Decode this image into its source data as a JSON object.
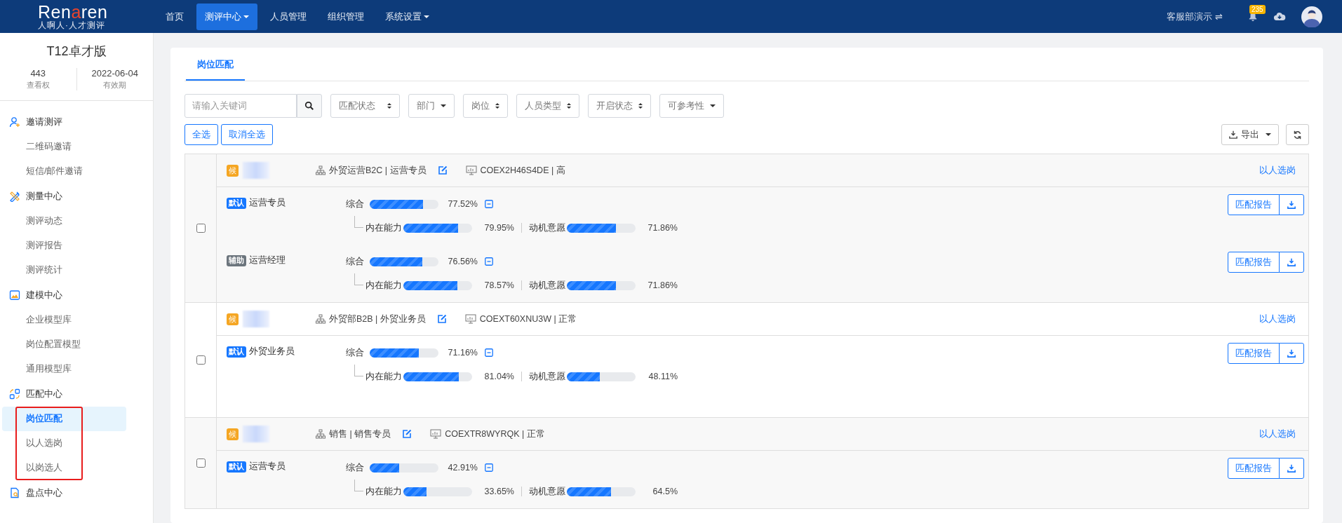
{
  "header": {
    "logo": [
      {
        "text": "Ren",
        "accent": false
      },
      {
        "text": "a",
        "accent": true
      },
      {
        "text": "ren",
        "accent": false
      }
    ],
    "tagline": "人啊人·人才测评",
    "nav": [
      {
        "label": "首页",
        "selected": false,
        "dropdown": false
      },
      {
        "label": "测评中心",
        "selected": true,
        "dropdown": true
      },
      {
        "label": "人员管理",
        "selected": false,
        "dropdown": false
      },
      {
        "label": "组织管理",
        "selected": false,
        "dropdown": false
      },
      {
        "label": "系统设置",
        "selected": false,
        "dropdown": true
      }
    ],
    "account": "客服部演示 ⇌",
    "notification_count": "235"
  },
  "sidebar": {
    "edition": "T12卓才版",
    "stats": [
      {
        "value": "443",
        "label": "查看权"
      },
      {
        "value": "2022-06-04",
        "label": "有效期"
      }
    ],
    "groups": [
      {
        "label": "邀请测评",
        "highlighted": false,
        "items": [
          {
            "label": "二维码邀请",
            "selected": false
          },
          {
            "label": "短信/邮件邀请",
            "selected": false
          }
        ]
      },
      {
        "label": "测量中心",
        "highlighted": false,
        "items": [
          {
            "label": "测评动态",
            "selected": false
          },
          {
            "label": "测评报告",
            "selected": false
          },
          {
            "label": "测评统计",
            "selected": false
          }
        ]
      },
      {
        "label": "建模中心",
        "highlighted": false,
        "items": [
          {
            "label": "企业模型库",
            "selected": false
          },
          {
            "label": "岗位配置模型",
            "selected": false
          },
          {
            "label": "通用模型库",
            "selected": false
          }
        ]
      },
      {
        "label": "匹配中心",
        "highlighted": true,
        "items": [
          {
            "label": "岗位匹配",
            "selected": true
          },
          {
            "label": "以人选岗",
            "selected": false
          },
          {
            "label": "以岗选人",
            "selected": false
          }
        ]
      },
      {
        "label": "盘点中心",
        "highlighted": false
      }
    ]
  },
  "main": {
    "tabs": [
      {
        "label": "岗位匹配",
        "selected": true
      }
    ],
    "search": {
      "placeholder": "请输入关键词"
    },
    "filters": [
      {
        "label": "匹配状态",
        "kind": "sort"
      },
      {
        "label": "部门",
        "kind": "caret"
      },
      {
        "label": "岗位",
        "kind": "sort"
      },
      {
        "label": "人员类型",
        "kind": "sort"
      },
      {
        "label": "开启状态",
        "kind": "sort"
      },
      {
        "label": "可参考性",
        "kind": "caret"
      }
    ],
    "select_buttons": [
      "全选",
      "取消全选"
    ],
    "export": "导出",
    "candidates": [
      {
        "badge": "候",
        "checked": false,
        "org": "外贸运营B2C | 运营专员",
        "code": "COEX2H46S4DE | 高",
        "action": "以人选岗",
        "jobs": [
          {
            "tag": {
              "text": "默认",
              "color": "#1677ff"
            },
            "title": "运营专员",
            "expanded": true,
            "overall": {
              "label": "综合",
              "level": 0.7752,
              "reading": "77.52%"
            },
            "details": [
              {
                "label": "内在能力",
                "level": 0.7995,
                "reading": "79.95%"
              },
              {
                "label": "动机意愿",
                "level": 0.7186,
                "reading": "71.86%"
              }
            ],
            "report": "匹配报告"
          },
          {
            "tag": {
              "text": "辅助",
              "color": "#6c757d"
            },
            "title": "运营经理",
            "expanded": true,
            "overall": {
              "label": "综合",
              "level": 0.7656,
              "reading": "76.56%"
            },
            "details": [
              {
                "label": "内在能力",
                "level": 0.7857,
                "reading": "78.57%"
              },
              {
                "label": "动机意愿",
                "level": 0.7186,
                "reading": "71.86%"
              }
            ],
            "report": "匹配报告"
          }
        ]
      },
      {
        "badge": "候",
        "checked": false,
        "org": "外贸部B2B | 外贸业务员",
        "code": "COEXT60XNU3W | 正常",
        "action": "以人选岗",
        "jobs": [
          {
            "tag": {
              "text": "默认",
              "color": "#1677ff"
            },
            "title": "外贸业务员",
            "expanded": true,
            "overall": {
              "label": "综合",
              "level": 0.7116,
              "reading": "71.16%"
            },
            "details": [
              {
                "label": "内在能力",
                "level": 0.8104,
                "reading": "81.04%"
              },
              {
                "label": "动机意愿",
                "level": 0.4811,
                "reading": "48.11%"
              }
            ],
            "report": "匹配报告"
          }
        ]
      },
      {
        "badge": "候",
        "checked": false,
        "org": "销售 | 销售专员",
        "code": "COEXTR8WYRQK | 正常",
        "action": "以人选岗",
        "jobs": [
          {
            "tag": {
              "text": "默认",
              "color": "#1677ff"
            },
            "title": "运营专员",
            "expanded": true,
            "overall": {
              "label": "综合",
              "level": 0.4291,
              "reading": "42.91%"
            },
            "details": [
              {
                "label": "内在能力",
                "level": 0.3365,
                "reading": "33.65%"
              },
              {
                "label": "动机意愿",
                "level": 0.645,
                "reading": "64.5%"
              }
            ],
            "report": "匹配报告"
          }
        ]
      }
    ]
  }
}
